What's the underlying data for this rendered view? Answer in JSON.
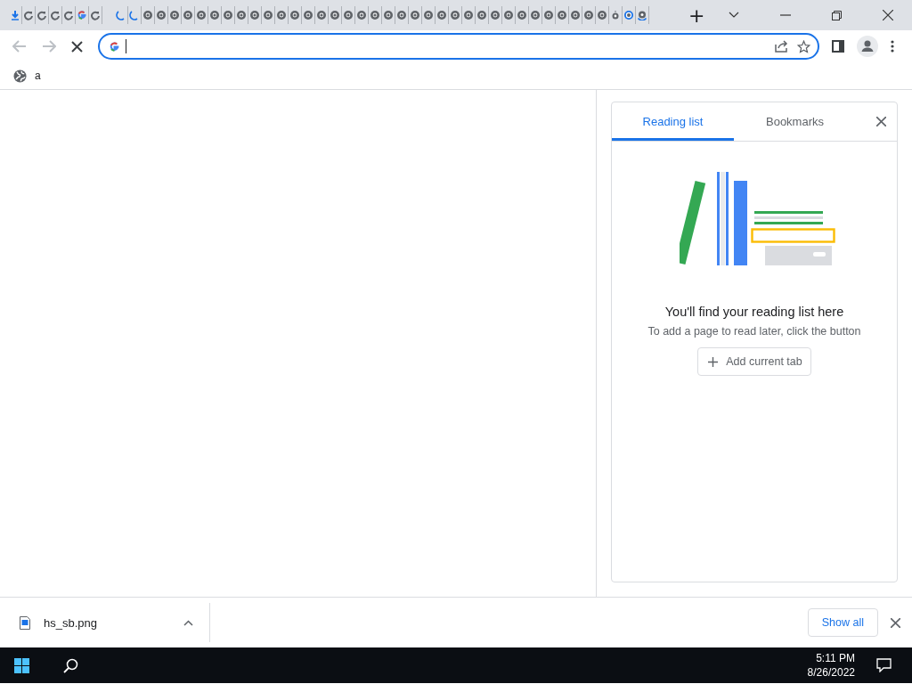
{
  "tabs": [
    {
      "kind": "download"
    },
    {
      "kind": "reload"
    },
    {
      "kind": "reload"
    },
    {
      "kind": "reload"
    },
    {
      "kind": "reload"
    },
    {
      "kind": "google"
    },
    {
      "kind": "reload"
    },
    {
      "kind": "gap"
    },
    {
      "kind": "spinner"
    },
    {
      "kind": "spinner"
    },
    {
      "kind": "chrome"
    },
    {
      "kind": "chrome"
    },
    {
      "kind": "chrome"
    },
    {
      "kind": "chrome"
    },
    {
      "kind": "chrome"
    },
    {
      "kind": "chrome"
    },
    {
      "kind": "chrome"
    },
    {
      "kind": "chrome"
    },
    {
      "kind": "chrome"
    },
    {
      "kind": "chrome"
    },
    {
      "kind": "chrome"
    },
    {
      "kind": "chrome"
    },
    {
      "kind": "chrome"
    },
    {
      "kind": "chrome"
    },
    {
      "kind": "chrome"
    },
    {
      "kind": "chrome"
    },
    {
      "kind": "chrome"
    },
    {
      "kind": "chrome"
    },
    {
      "kind": "chrome"
    },
    {
      "kind": "chrome"
    },
    {
      "kind": "chrome"
    },
    {
      "kind": "chrome"
    },
    {
      "kind": "chrome"
    },
    {
      "kind": "chrome"
    },
    {
      "kind": "chrome"
    },
    {
      "kind": "chrome"
    },
    {
      "kind": "chrome"
    },
    {
      "kind": "chrome"
    },
    {
      "kind": "chrome"
    },
    {
      "kind": "chrome"
    },
    {
      "kind": "chrome"
    },
    {
      "kind": "chrome"
    },
    {
      "kind": "chrome"
    },
    {
      "kind": "chrome"
    },
    {
      "kind": "chrome"
    },
    {
      "kind": "chrome-small"
    },
    {
      "kind": "chrome-blue"
    },
    {
      "kind": "chrome-loading"
    }
  ],
  "new_tab": "+",
  "bookmarks_bar": [
    {
      "label": "a"
    }
  ],
  "side_panel": {
    "tabs": [
      {
        "label": "Reading list",
        "selected": true
      },
      {
        "label": "Bookmarks",
        "selected": false
      }
    ],
    "title": "You'll find your reading list here",
    "description": "To add a page to read later, click the button",
    "button": "Add current tab"
  },
  "downloads": {
    "items": [
      {
        "filename": "hs_sb.png"
      }
    ],
    "show_all": "Show all"
  },
  "taskbar": {
    "time": "5:11 PM",
    "date": "8/26/2022"
  }
}
